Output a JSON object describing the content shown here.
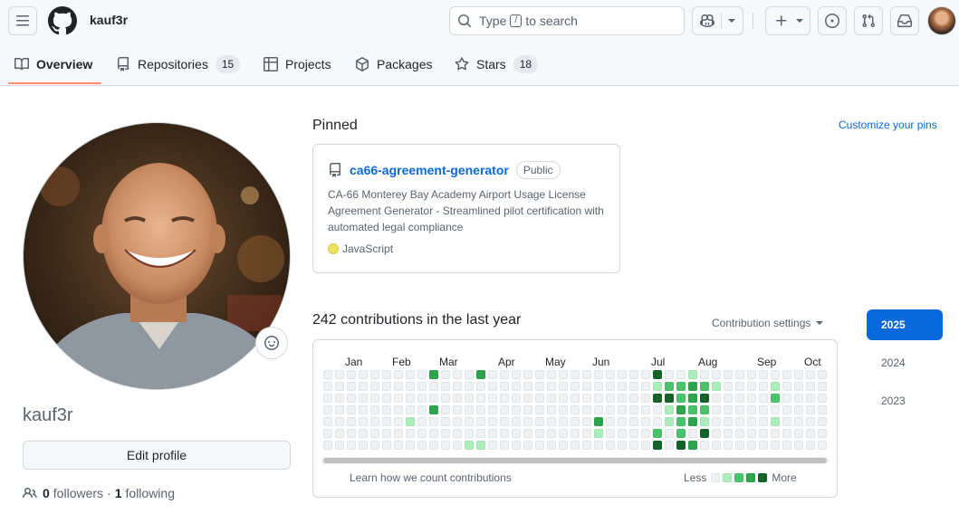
{
  "header": {
    "username": "kauf3r",
    "search_prefix": "Type",
    "search_key": "/",
    "search_suffix": "to search"
  },
  "tabs": [
    {
      "label": "Overview",
      "count": null,
      "icon": "book-icon",
      "selected": true
    },
    {
      "label": "Repositories",
      "count": "15",
      "icon": "repo-icon"
    },
    {
      "label": "Projects",
      "count": null,
      "icon": "table-icon"
    },
    {
      "label": "Packages",
      "count": null,
      "icon": "package-icon"
    },
    {
      "label": "Stars",
      "count": "18",
      "icon": "star-icon"
    }
  ],
  "profile": {
    "username": "kauf3r",
    "edit_label": "Edit profile",
    "followers_count": "0",
    "followers_label": "followers",
    "separator": "·",
    "following_count": "1",
    "following_label": "following"
  },
  "pinned": {
    "title": "Pinned",
    "customize_label": "Customize your pins",
    "repo": {
      "name": "ca66-agreement-generator",
      "visibility": "Public",
      "description": "CA-66 Monterey Bay Academy Airport Usage License Agreement Generator - Streamlined pilot certification with automated legal compliance",
      "language": "JavaScript",
      "language_color": "#f1e05a"
    }
  },
  "contributions": {
    "title": "242 contributions in the last year",
    "settings_label": "Contribution settings",
    "months": [
      "Jan",
      "Feb",
      "Mar",
      "Apr",
      "May",
      "Jun",
      "Jul",
      "Aug",
      "Sep",
      "Oct"
    ],
    "learn_label": "Learn how we count contributions",
    "less_label": "Less",
    "more_label": "More",
    "colors": [
      "#eff2f5",
      "#aceebb",
      "#4ac26b",
      "#2da44e",
      "#116329"
    ],
    "active_cells": [
      [
        9,
        0,
        3
      ],
      [
        13,
        0,
        3
      ],
      [
        28,
        0,
        4
      ],
      [
        31,
        0,
        1
      ],
      [
        28,
        1,
        1
      ],
      [
        29,
        1,
        2
      ],
      [
        30,
        1,
        2
      ],
      [
        31,
        1,
        3
      ],
      [
        32,
        1,
        2
      ],
      [
        33,
        1,
        1
      ],
      [
        38,
        1,
        1
      ],
      [
        28,
        2,
        4
      ],
      [
        29,
        2,
        4
      ],
      [
        30,
        2,
        2
      ],
      [
        31,
        2,
        3
      ],
      [
        32,
        2,
        4
      ],
      [
        38,
        2,
        2
      ],
      [
        9,
        3,
        3
      ],
      [
        29,
        3,
        1
      ],
      [
        30,
        3,
        3
      ],
      [
        31,
        3,
        2
      ],
      [
        32,
        3,
        2
      ],
      [
        7,
        4,
        1
      ],
      [
        23,
        4,
        3
      ],
      [
        29,
        4,
        1
      ],
      [
        30,
        4,
        2
      ],
      [
        31,
        4,
        3
      ],
      [
        32,
        4,
        1
      ],
      [
        38,
        4,
        1
      ],
      [
        23,
        5,
        1
      ],
      [
        28,
        5,
        2
      ],
      [
        30,
        5,
        2
      ],
      [
        32,
        5,
        4
      ],
      [
        12,
        6,
        1
      ],
      [
        13,
        6,
        1
      ],
      [
        28,
        6,
        4
      ],
      [
        30,
        6,
        4
      ],
      [
        31,
        6,
        3
      ]
    ]
  },
  "years": [
    "2025",
    "2024",
    "2023"
  ]
}
